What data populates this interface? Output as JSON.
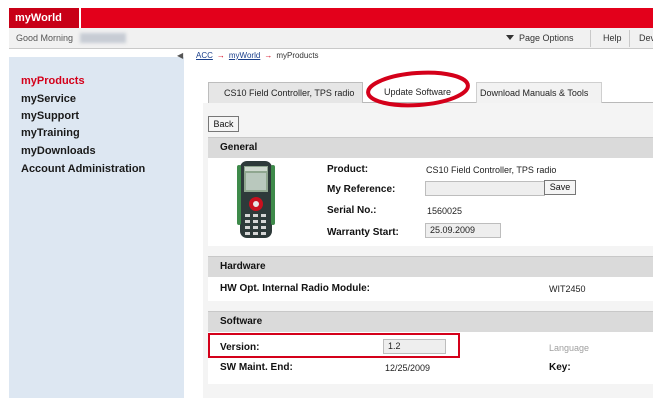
{
  "header": {
    "brand": "myWorld"
  },
  "greeting_bar": {
    "greeting": "Good Morning",
    "page_options": "Page Options",
    "help": "Help",
    "more": "Dev"
  },
  "sidebar": {
    "items": [
      {
        "label": "myProducts"
      },
      {
        "label": "myService"
      },
      {
        "label": "mySupport"
      },
      {
        "label": "myTraining"
      },
      {
        "label": "myDownloads"
      },
      {
        "label": "Account Administration"
      }
    ]
  },
  "breadcrumb": {
    "items": [
      "ACC",
      "myWorld",
      "myProducts"
    ],
    "separator": "→"
  },
  "tabs": [
    {
      "label": "CS10 Field Controller, TPS radio"
    },
    {
      "label": "Update Software"
    },
    {
      "label": "Download Manuals & Tools"
    }
  ],
  "buttons": {
    "back": "Back",
    "save": "Save"
  },
  "general": {
    "heading": "General",
    "product_label": "Product:",
    "product_value": "CS10 Field Controller, TPS radio",
    "reference_label": "My Reference:",
    "reference_value": "",
    "serial_label": "Serial No.:",
    "serial_value": "1560025",
    "warranty_label": "Warranty Start:",
    "warranty_value": "25.09.2009"
  },
  "hardware": {
    "heading": "Hardware",
    "module_label": "HW Opt. Internal Radio Module:",
    "module_value": "WIT2450"
  },
  "software": {
    "heading": "Software",
    "version_label": "Version:",
    "version_value": "1.2",
    "language_label": "Language",
    "maint_label": "SW Maint. End:",
    "maint_value": "12/25/2009",
    "key_label": "Key:"
  },
  "colors": {
    "brand_red": "#e3001b",
    "sidebar_bg": "#dde7f2",
    "highlight": "#d4001a"
  },
  "icons": {
    "device": "handheld-controller-image",
    "collapse": "collapse-arrow-icon",
    "dropdown": "triangle-down-icon"
  }
}
